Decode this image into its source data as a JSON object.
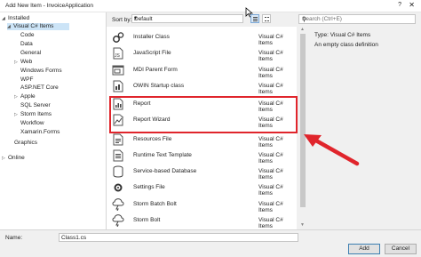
{
  "window": {
    "title": "Add New Item - InvoiceApplication",
    "help_glyph": "?",
    "close_glyph": "✕"
  },
  "tree": {
    "installed": "Installed",
    "visual_cs_items": "Visual C# Items",
    "children": [
      "Code",
      "Data",
      "General",
      "Web",
      "Windows Forms",
      "WPF",
      "ASP.NET Core",
      "Apple",
      "SQL Server",
      "Storm Items",
      "Workflow",
      "Xamarin.Forms"
    ],
    "graphics": "Graphics",
    "online": "Online"
  },
  "toolbar": {
    "sort_label": "Sort by:",
    "sort_value": "Default",
    "search_placeholder": "Search (Ctrl+E)"
  },
  "templates": [
    {
      "name": "Installer Class",
      "type": "Visual C# Items",
      "icon": "gears-icon"
    },
    {
      "name": "JavaScript File",
      "type": "Visual C# Items",
      "icon": "js-file-icon"
    },
    {
      "name": "MDI Parent Form",
      "type": "Visual C# Items",
      "icon": "form-icon"
    },
    {
      "name": "OWIN Startup class",
      "type": "Visual C# Items",
      "icon": "owin-icon"
    },
    {
      "name": "Report",
      "type": "Visual C# Items",
      "icon": "report-icon"
    },
    {
      "name": "Report Wizard",
      "type": "Visual C# Items",
      "icon": "report-wizard-icon"
    },
    {
      "name": "Resources File",
      "type": "Visual C# Items",
      "icon": "resources-icon"
    },
    {
      "name": "Runtime Text Template",
      "type": "Visual C# Items",
      "icon": "text-template-icon"
    },
    {
      "name": "Service-based Database",
      "type": "Visual C# Items",
      "icon": "database-icon"
    },
    {
      "name": "Settings File",
      "type": "Visual C# Items",
      "icon": "settings-icon"
    },
    {
      "name": "Storm Batch Bolt",
      "type": "Visual C# Items",
      "icon": "storm-icon"
    },
    {
      "name": "Storm Bolt",
      "type": "Visual C# Items",
      "icon": "storm-icon"
    }
  ],
  "detail": {
    "type_line": "Type:  Visual C# Items",
    "description": "An empty class definition"
  },
  "footer": {
    "name_label": "Name:",
    "name_value": "Class1.cs",
    "add_label": "Add",
    "cancel_label": "Cancel"
  },
  "colors": {
    "highlight": "#e0252c",
    "selection": "#cce4f7"
  }
}
